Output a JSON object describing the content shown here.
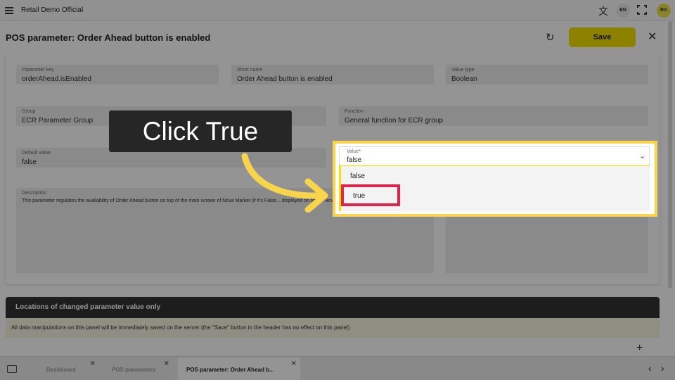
{
  "app": {
    "title": "Retail Demo Official",
    "lang": "EN",
    "avatar": "RA"
  },
  "header": {
    "title": "POS parameter: Order Ahead button is enabled",
    "save_label": "Save"
  },
  "fields": {
    "param_key": {
      "label": "Parameter key",
      "value": "orderAhead.isEnabled"
    },
    "short_name": {
      "label": "Short name",
      "value": "Order Ahead button is enabled"
    },
    "value_type": {
      "label": "Value type",
      "value": "Boolean"
    },
    "group": {
      "label": "Group",
      "value": "ECR Parameter Group"
    },
    "function": {
      "label": "Function",
      "value": "General function for ECR group"
    },
    "default_value": {
      "label": "Default value",
      "value": "false"
    },
    "description": {
      "label": "Description",
      "value": "This parameter regulates the availability of Order Ahead button on top of the main screen of Nova Market (if it's False... displayed on top of Nova Market main screen."
    },
    "value": {
      "label": "Value",
      "required_mark": "*",
      "current": "false",
      "options": [
        "false",
        "true"
      ]
    }
  },
  "locations": {
    "title": "Locations of changed parameter value only",
    "note": "All data manipulations on this panel will be immediately saved on the server (the \"Save\" button in the header has no effect on this panel)"
  },
  "tabs": [
    {
      "label": "Dashboard"
    },
    {
      "label": "POS parameters"
    },
    {
      "label": "POS parameter: Order Ahead b..."
    }
  ],
  "callout": {
    "text": "Click True"
  },
  "colors": {
    "accent": "#f2e100",
    "highlight": "#f7d44c",
    "target": "#e4234a",
    "callout_bg": "#262626"
  }
}
